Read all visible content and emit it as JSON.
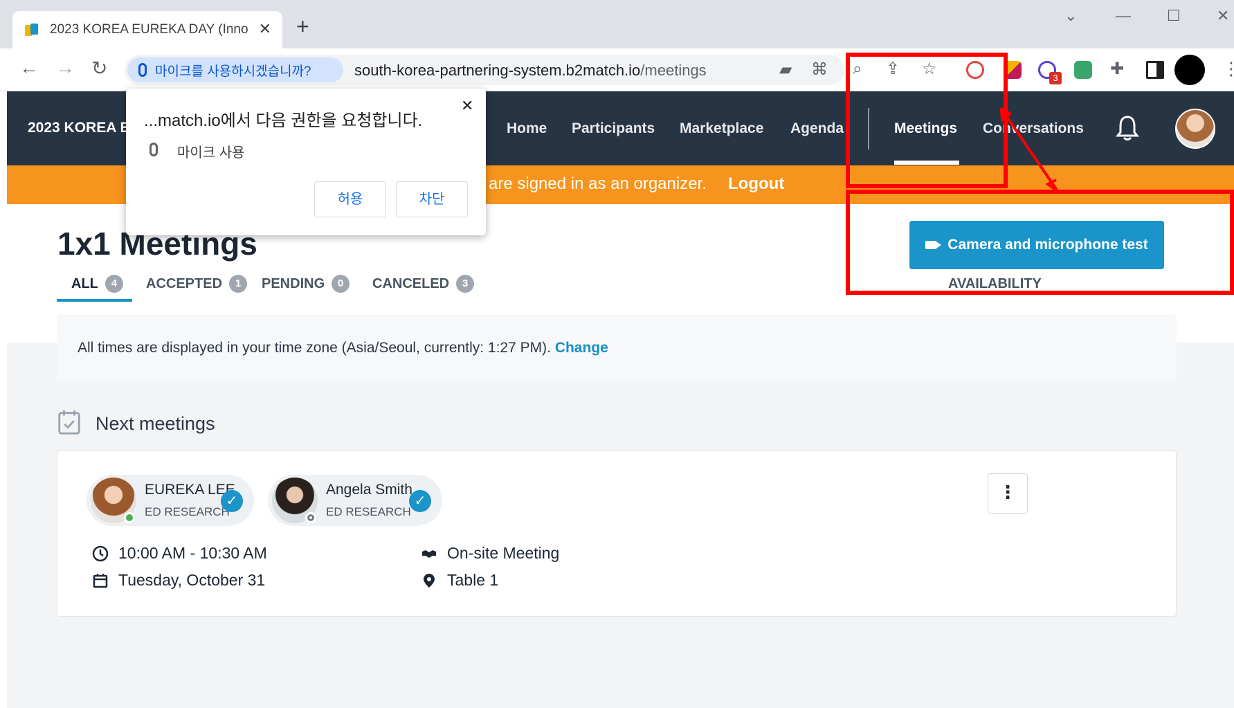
{
  "browser": {
    "tab_title": "2023 KOREA EUREKA DAY (Inno",
    "tab_close": "✕",
    "new_tab": "+",
    "mic_chip_label": "마이크를 사용하시겠습니까?",
    "url_host": "south-korea-partnering-system.b2match.io",
    "url_path": "/meetings",
    "extension_badge": "3"
  },
  "permission_popup": {
    "title": "...match.io에서 다음 권한을 요청합니다.",
    "item": "마이크 사용",
    "allow": "허용",
    "block": "차단",
    "close": "✕"
  },
  "site_nav": {
    "brand": "2023 KOREA EU",
    "links": [
      "Home",
      "Participants",
      "Marketplace",
      "Agenda",
      "Meetings",
      "Conversations"
    ],
    "active": "Meetings"
  },
  "org_bar": {
    "text": "are signed in as an organizer.",
    "logout": "Logout"
  },
  "page": {
    "title": "1x1 Meetings",
    "camera_test": "Camera and microphone test",
    "tabs": [
      {
        "label": "ALL",
        "count": "4"
      },
      {
        "label": "ACCEPTED",
        "count": "1"
      },
      {
        "label": "PENDING",
        "count": "0"
      },
      {
        "label": "CANCELED",
        "count": "3"
      }
    ],
    "availability": "AVAILABILITY",
    "timezone_text": "All times are displayed in your time zone (Asia/Seoul, currently: 1:27 PM).",
    "timezone_change": "Change",
    "next_meetings": "Next meetings"
  },
  "meeting": {
    "participants": [
      {
        "name": "EUREKA LEE",
        "org": "ED RESEARCH",
        "status": "online"
      },
      {
        "name": "Angela Smith",
        "org": "ED RESEARCH",
        "status": "offline"
      }
    ],
    "time": "10:00 AM - 10:30 AM",
    "date": "Tuesday, October 31",
    "type": "On-site Meeting",
    "location": "Table 1"
  },
  "colors": {
    "nav_bg": "#273444",
    "org_bar": "#f7941d",
    "accent": "#1a94c9",
    "annotation": "#ff0000"
  }
}
